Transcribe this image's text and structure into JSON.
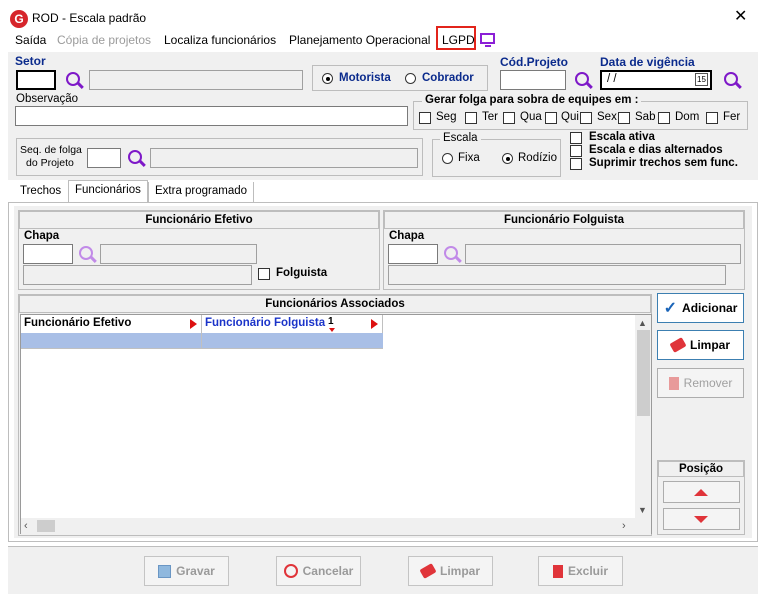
{
  "window": {
    "title": "ROD - Escala padrão",
    "app_icon": "G"
  },
  "menu": [
    {
      "label": "Saída"
    },
    {
      "label": "Cópia de projetos"
    },
    {
      "label": "Localiza funcionários"
    },
    {
      "label": "Planejamento Operacional"
    },
    {
      "label": "LGPD"
    }
  ],
  "top": {
    "setor_label": "Setor",
    "cod_projeto_label": "Cód.Projeto",
    "data_vigencia_label": "Data de vigência",
    "data_vigencia_value": "/ /",
    "calendar_day": "15",
    "motorista": "Motorista",
    "cobrador": "Cobrador",
    "observacao_label": "Observação",
    "gerar_folga_label": "Gerar folga para sobra de equipes em :",
    "days": [
      "Seg",
      "Ter",
      "Qua",
      "Qui",
      "Sex",
      "Sab",
      "Dom",
      "Fer"
    ],
    "seq_folga_label_1": "Seq. de folga",
    "seq_folga_label_2": "do Projeto",
    "escala_label": "Escala",
    "fixa": "Fixa",
    "rodizio": "Rodízio",
    "escala_ativa": "Escala ativa",
    "escala_dias": "Escala e dias alternados",
    "suprimir": "Suprimir trechos sem func."
  },
  "tabs": [
    {
      "label": "Trechos"
    },
    {
      "label": "Funcionários"
    },
    {
      "label": "Extra programado"
    }
  ],
  "efetivo": {
    "title": "Funcionário Efetivo",
    "chapa": "Chapa",
    "folguista": "Folguista"
  },
  "folguista": {
    "title": "Funcionário Folguista",
    "chapa": "Chapa"
  },
  "associados": {
    "title": "Funcionários Associados",
    "col1": "Funcionário Efetivo",
    "col2": "Funcionário Folguista",
    "sort_index": "1"
  },
  "actions": {
    "adicionar": "Adicionar",
    "limpar": "Limpar",
    "remover": "Remover",
    "posicao": "Posição"
  },
  "bottom": {
    "gravar": "Gravar",
    "cancelar": "Cancelar",
    "limpar": "Limpar",
    "excluir": "Excluir"
  },
  "colors": {
    "accent": "#7e18c8",
    "highlight": "#e2241b",
    "row_selected": "#a9bfe6"
  }
}
